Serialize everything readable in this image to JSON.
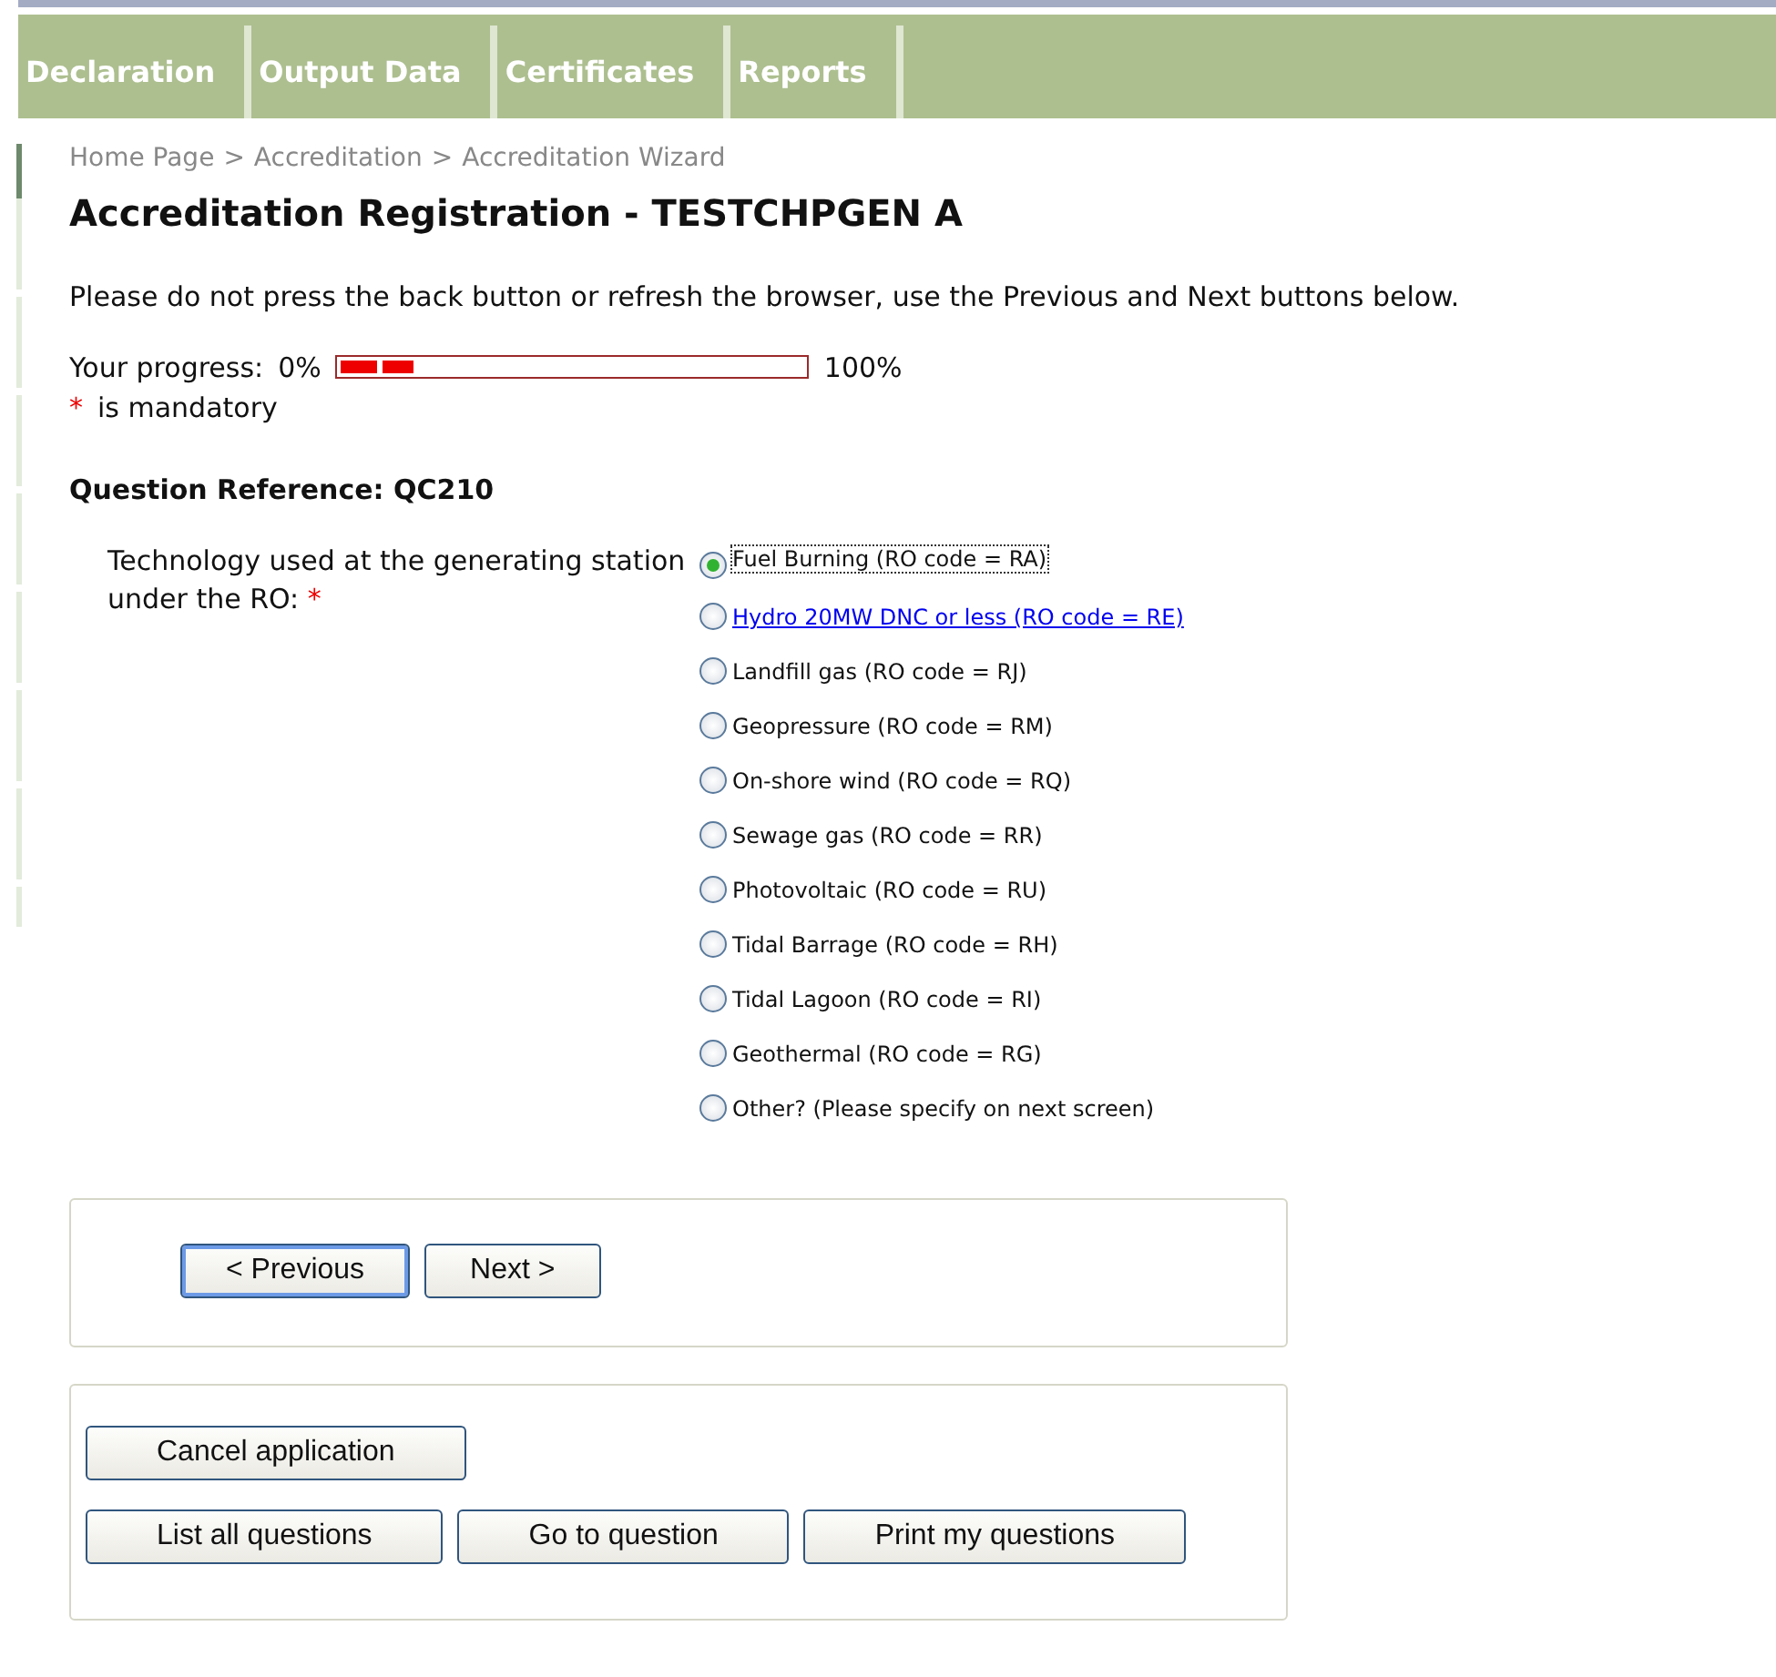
{
  "nav": {
    "tabs": [
      {
        "label": "Declaration"
      },
      {
        "label": "Output Data"
      },
      {
        "label": "Certificates"
      },
      {
        "label": "Reports"
      }
    ]
  },
  "breadcrumb": [
    "Home Page",
    ">",
    "Accreditation",
    ">",
    "Accreditation Wizard"
  ],
  "title": "Accreditation Registration - TESTCHPGEN A",
  "notice": "Please do not press the back button or refresh the browser, use the Previous and Next buttons below.",
  "progress": {
    "label": "Your progress:",
    "start": "0%",
    "end": "100%",
    "level": 0.17
  },
  "mandatory": {
    "mark": "*",
    "text": "is mandatory"
  },
  "question_reference": "Question Reference: QC210",
  "question": {
    "label": "Technology used at the generating station under the RO:",
    "required_mark": "*",
    "options": [
      {
        "label": "Fuel Burning (RO code = RA)",
        "selected": true,
        "focused": true,
        "kind": "plain"
      },
      {
        "label": "Hydro 20MW DNC or less (RO code = RE)",
        "selected": false,
        "focused": false,
        "kind": "link"
      },
      {
        "label": "Landfill gas (RO code = RJ)",
        "selected": false,
        "focused": false,
        "kind": "plain"
      },
      {
        "label": "Geopressure (RO code = RM)",
        "selected": false,
        "focused": false,
        "kind": "plain"
      },
      {
        "label": "On-shore wind (RO code = RQ)",
        "selected": false,
        "focused": false,
        "kind": "plain"
      },
      {
        "label": "Sewage gas (RO code = RR)",
        "selected": false,
        "focused": false,
        "kind": "plain"
      },
      {
        "label": "Photovoltaic (RO code = RU)",
        "selected": false,
        "focused": false,
        "kind": "plain"
      },
      {
        "label": "Tidal Barrage (RO code = RH)",
        "selected": false,
        "focused": false,
        "kind": "plain"
      },
      {
        "label": "Tidal Lagoon (RO code = RI)",
        "selected": false,
        "focused": false,
        "kind": "plain"
      },
      {
        "label": "Geothermal (RO code = RG)",
        "selected": false,
        "focused": false,
        "kind": "plain"
      },
      {
        "label": "Other? (Please specify on next screen)",
        "selected": false,
        "focused": false,
        "kind": "plain"
      }
    ]
  },
  "navigation_buttons": [
    {
      "label": "< Previous",
      "focused": true
    },
    {
      "label": "Next >",
      "focused": false
    }
  ],
  "action_buttons": [
    [
      "Cancel application"
    ],
    [
      "List all questions",
      "Go to question",
      "Print my questions"
    ]
  ]
}
